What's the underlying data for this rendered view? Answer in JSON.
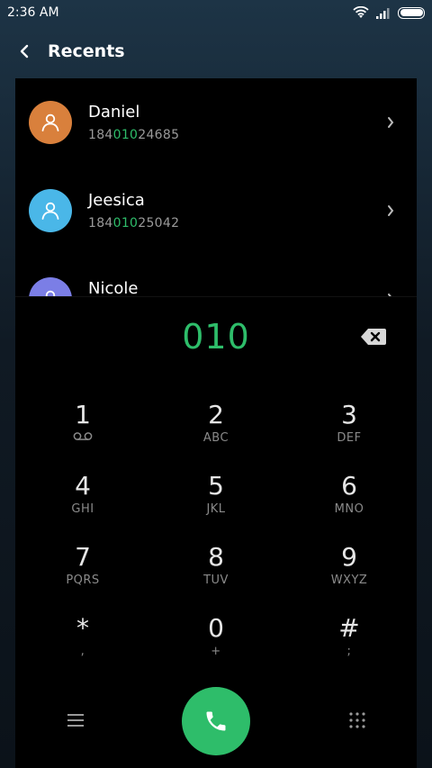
{
  "status_bar": {
    "time": "2:36 AM"
  },
  "header": {
    "title": "Recents"
  },
  "contacts": [
    {
      "name": "Daniel",
      "number_pre": "184",
      "number_match": "010",
      "number_post": "24685",
      "avatar_color": "#d9803c"
    },
    {
      "name": "Jeesica",
      "number_pre": "184",
      "number_match": "010",
      "number_post": "25042",
      "avatar_color": "#4ab7e8"
    },
    {
      "name": "Nicole",
      "number_pre": "",
      "number_match": "",
      "number_post": "",
      "avatar_color": "#7b7ee6"
    }
  ],
  "dialer": {
    "input": "010",
    "keys": [
      {
        "digit": "1",
        "letters": ""
      },
      {
        "digit": "2",
        "letters": "ABC"
      },
      {
        "digit": "3",
        "letters": "DEF"
      },
      {
        "digit": "4",
        "letters": "GHI"
      },
      {
        "digit": "5",
        "letters": "JKL"
      },
      {
        "digit": "6",
        "letters": "MNO"
      },
      {
        "digit": "7",
        "letters": "PQRS"
      },
      {
        "digit": "8",
        "letters": "TUV"
      },
      {
        "digit": "9",
        "letters": "WXYZ"
      },
      {
        "digit": "*",
        "letters": ","
      },
      {
        "digit": "0",
        "letters": "+"
      },
      {
        "digit": "#",
        "letters": ";"
      }
    ]
  },
  "colors": {
    "accent": "#2ebd6a",
    "panel": "#000000"
  }
}
